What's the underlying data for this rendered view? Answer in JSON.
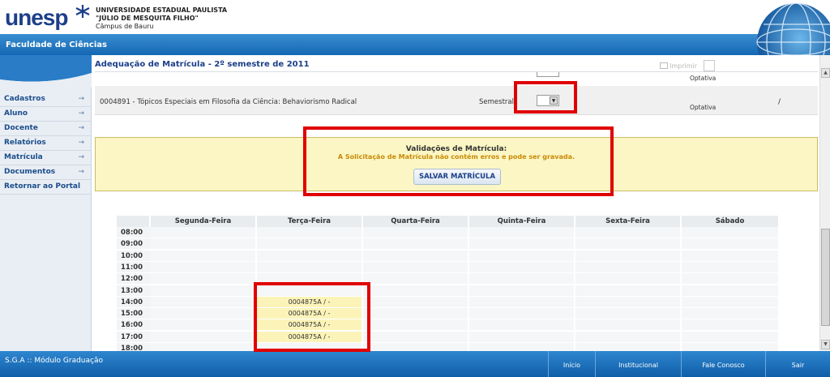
{
  "header": {
    "logo_text": "unesp",
    "university_line1": "UNIVERSIDADE ESTADUAL PAULISTA",
    "university_line2": "\"JÚLIO DE MESQUITA FILHO\"",
    "university_line3": "Câmpus de Bauru"
  },
  "topbar": {
    "faculty": "Faculdade de Ciências"
  },
  "sidebar": {
    "items": [
      {
        "label": "Cadastros",
        "arrow": "→"
      },
      {
        "label": "Aluno",
        "arrow": "→"
      },
      {
        "label": "Docente",
        "arrow": "→"
      },
      {
        "label": "Relatórios",
        "arrow": "→"
      },
      {
        "label": "Matrícula",
        "arrow": "→"
      },
      {
        "label": "Documentos",
        "arrow": "→"
      },
      {
        "label": "Retornar ao Portal",
        "arrow": ""
      }
    ]
  },
  "main": {
    "title": "Adequação de Matrícula - 2º semestre de 2011",
    "print_label": "Imprimir",
    "prev_row_category": "Optativa",
    "discipline": {
      "name": "0004891 - Tópicos Especiais em Filosofia da Ciência: Behaviorismo Radical",
      "period": "Semestral",
      "category": "Optativa",
      "slash": "/"
    },
    "validation": {
      "title": "Validações de Matrícula:",
      "message": "A Solicitação de Matrícula não contém erros e pode ser gravada.",
      "save_button": "SALVAR MATRÍCULA"
    },
    "schedule": {
      "days": [
        "Segunda-Feira",
        "Terça-Feira",
        "Quarta-Feira",
        "Quinta-Feira",
        "Sexta-Feira",
        "Sábado"
      ],
      "rows": [
        {
          "time": "08:00",
          "cells": [
            "",
            "",
            "",
            "",
            "",
            ""
          ]
        },
        {
          "time": "09:00",
          "cells": [
            "",
            "",
            "",
            "",
            "",
            ""
          ]
        },
        {
          "time": "10:00",
          "cells": [
            "",
            "",
            "",
            "",
            "",
            ""
          ]
        },
        {
          "time": "11:00",
          "cells": [
            "",
            "",
            "",
            "",
            "",
            ""
          ]
        },
        {
          "time": "12:00",
          "cells": [
            "",
            "",
            "",
            "",
            "",
            ""
          ]
        },
        {
          "time": "13:00",
          "cells": [
            "",
            "",
            "",
            "",
            "",
            ""
          ]
        },
        {
          "time": "14:00",
          "cells": [
            "",
            "0004875A / -",
            "",
            "",
            "",
            ""
          ]
        },
        {
          "time": "15:00",
          "cells": [
            "",
            "0004875A / -",
            "",
            "",
            "",
            ""
          ]
        },
        {
          "time": "16:00",
          "cells": [
            "",
            "0004875A / -",
            "",
            "",
            "",
            ""
          ]
        },
        {
          "time": "17:00",
          "cells": [
            "",
            "0004875A / -",
            "",
            "",
            "",
            ""
          ]
        },
        {
          "time": "18:00",
          "cells": [
            "",
            "",
            "",
            "",
            "",
            ""
          ]
        }
      ]
    }
  },
  "footer": {
    "title": "S.G.A :: Módulo Graduação",
    "links": [
      "Início",
      "Institucional",
      "Fale Conosco",
      "Sair"
    ]
  },
  "colors": {
    "brand_blue": "#1c3f8a",
    "bar_blue": "#1467b3",
    "highlight_red": "#e00000",
    "validation_bg": "#fbf6c3",
    "scheduled_cell": "#fbf3b8"
  }
}
